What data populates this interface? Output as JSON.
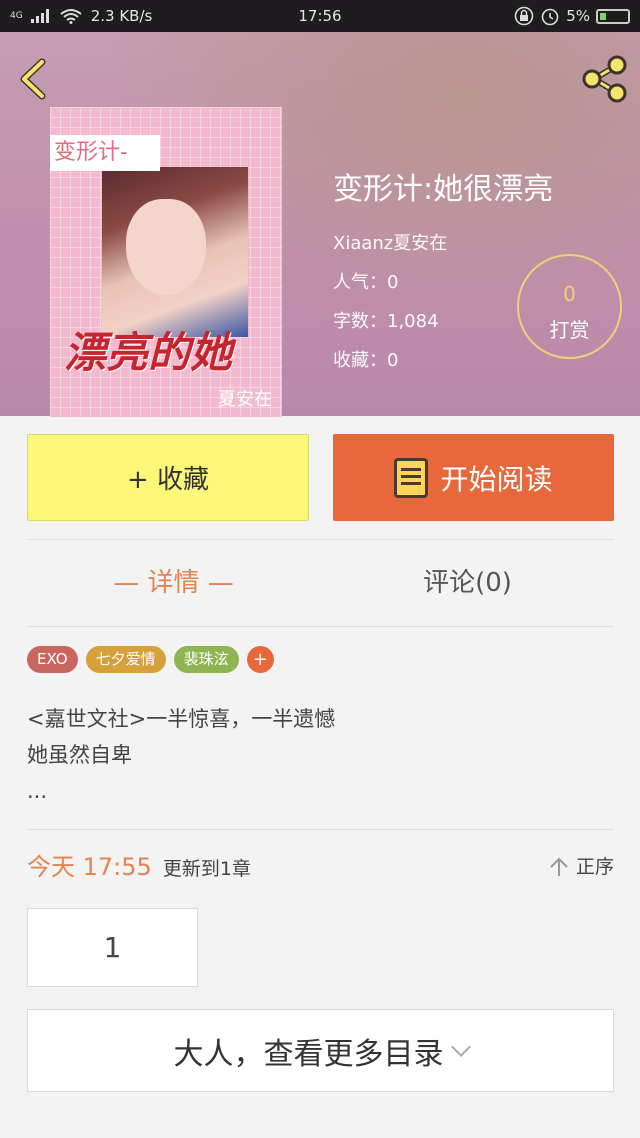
{
  "status_bar": {
    "network": "4G",
    "speed": "2.3 KB/s",
    "time": "17:56",
    "battery": "5%"
  },
  "book": {
    "cover": {
      "tag": "变形计-",
      "title": "漂亮的她",
      "author": "夏安在"
    },
    "title": "变形计:她很漂亮",
    "author": "Xiaanz夏安在",
    "popularity": "人气：0",
    "word_count": "字数：1,084",
    "favorites": "收藏：0",
    "reward": {
      "count": "0",
      "label": "打赏"
    }
  },
  "actions": {
    "favorite": "+ 收藏",
    "read": "开始阅读"
  },
  "tabs": {
    "detail": "— 详情 —",
    "comments": "评论(0)"
  },
  "tags": [
    {
      "label": "EXO",
      "color": "#c8665f"
    },
    {
      "label": "七夕爱情",
      "color": "#d6a03a"
    },
    {
      "label": "裴珠泫",
      "color": "#8fb452"
    }
  ],
  "tag_add": "+",
  "description": [
    "<嘉世文社>一半惊喜，一半遗憾",
    "她虽然自卑",
    "..."
  ],
  "update": {
    "time": "今天 17:55",
    "text": "更新到1章",
    "order": "正序"
  },
  "chapter": "1",
  "more_catalog": "大人，查看更多目录",
  "colors": {
    "accent": "#e8683c",
    "favorite_bg": "#fcf779",
    "tab_active": "#e3834f"
  },
  "icons": {
    "back": "chevron-left-icon",
    "share": "share-icon",
    "read": "book-icon",
    "order": "arrow-up-icon",
    "more": "chevron-down-icon"
  }
}
